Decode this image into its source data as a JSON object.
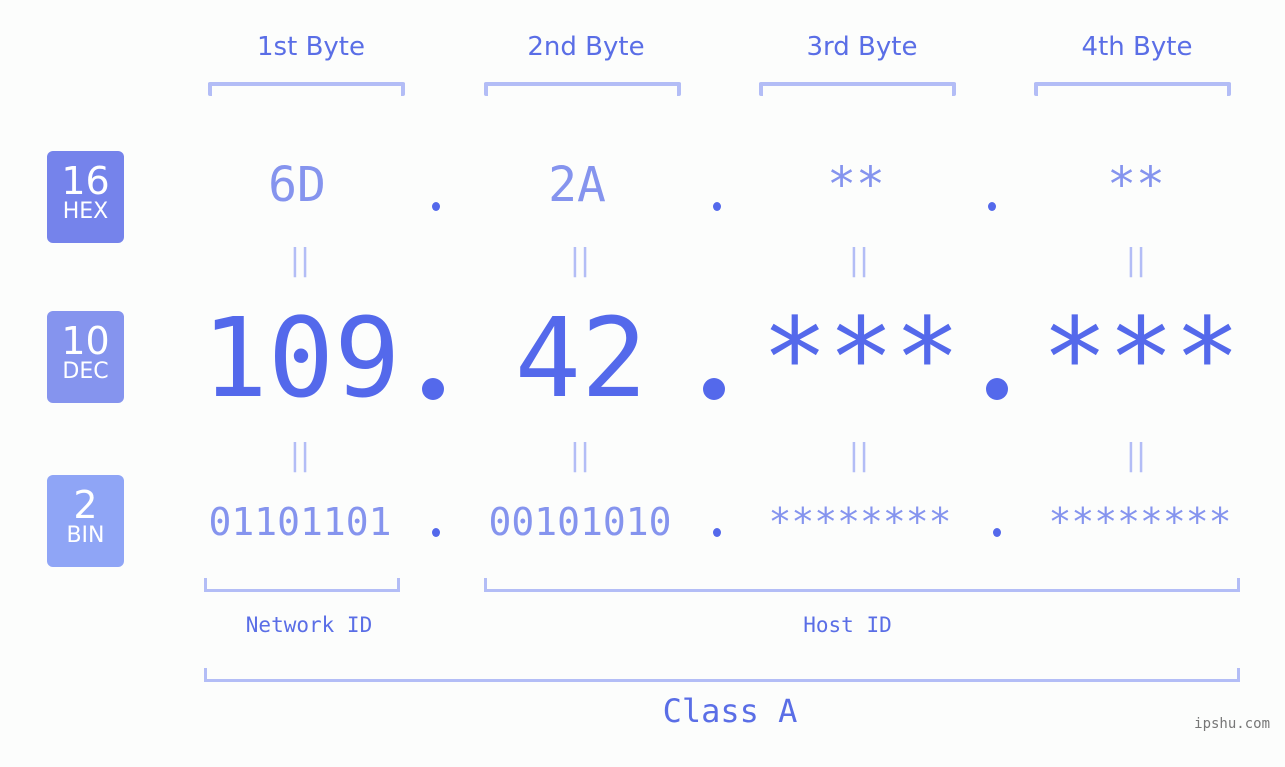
{
  "bytes": [
    {
      "header": "1st Byte",
      "hex": "6D",
      "dec": "109",
      "bin": "01101101"
    },
    {
      "header": "2nd Byte",
      "hex": "2A",
      "dec": "42",
      "bin": "00101010"
    },
    {
      "header": "3rd Byte",
      "hex": "**",
      "dec": "***",
      "bin": "********"
    },
    {
      "header": "4th Byte",
      "hex": "**",
      "dec": "***",
      "bin": "********"
    }
  ],
  "badges": {
    "hex": {
      "num": "16",
      "label": "HEX",
      "color": "#7583eb"
    },
    "dec": {
      "num": "10",
      "label": "DEC",
      "color": "#8594ee"
    },
    "bin": {
      "num": "2",
      "label": "BIN",
      "color": "#8fa5f6"
    }
  },
  "equals_glyph": "||",
  "segments": {
    "network": "Network ID",
    "host": "Host ID",
    "class": "Class A"
  },
  "watermark": "ipshu.com",
  "colors": {
    "accent": "#5469eb",
    "light_accent": "#8594ee",
    "bracket": "#b3bdf6",
    "background": "#fcfdfc"
  }
}
